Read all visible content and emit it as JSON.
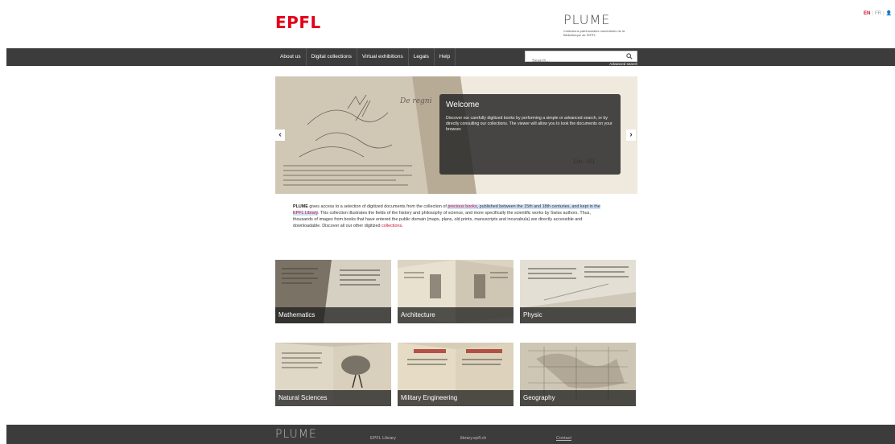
{
  "lang": {
    "en": "EN",
    "fr": "FR",
    "user": "Login"
  },
  "header": {
    "epfl_logo": "EPFL",
    "plume_logo": "PLUME",
    "plume_subtitle": "Collections patrimoniales numérisées de la Bibliothèque de l'EPFL"
  },
  "nav": {
    "items": [
      "About us",
      "Digital collections",
      "Virtual exhibitions",
      "Legals",
      "Help"
    ],
    "search_placeholder": "Search...",
    "advanced_search": "Advanced search"
  },
  "carousel": {
    "title": "Welcome",
    "text": "Discover our carefully digitized books by performing a simple or advanced search, or by directly consulting our collections. The viewer will allow you to look the documents on your browser.",
    "prev": "‹",
    "next": "›"
  },
  "intro": {
    "brand": "PLUME",
    "part1": " gives access to a selection of digitized documents from the collection of ",
    "link1": "precious books",
    "part2": ", published between the 15th and 18th centuries, and kept in the ",
    "link2": "EPFL Library",
    "part3": ". This collection illustrates the fields of the history and philosophy of science, and more specifically the scientific works by Swiss authors. Thus, thousands of images from books that have entered the public domain (maps, plans, old prints, manuscripts and incunabula) are directly accessible and downloadable. Discover all our other digitized ",
    "link3": "collections",
    "part4": "."
  },
  "tiles": [
    "Mathematics",
    "Architecture",
    "Physic",
    "Natural Sciences",
    "Military Engineering",
    "Geography"
  ],
  "footer": {
    "logo": "PLUME",
    "library": "EPFL Library",
    "url": "library.epfl.ch",
    "contact": "Contact"
  },
  "colors": {
    "accent": "#c8102e",
    "epfl_red": "#e2001a",
    "nav_bg": "#3c3c3c"
  }
}
